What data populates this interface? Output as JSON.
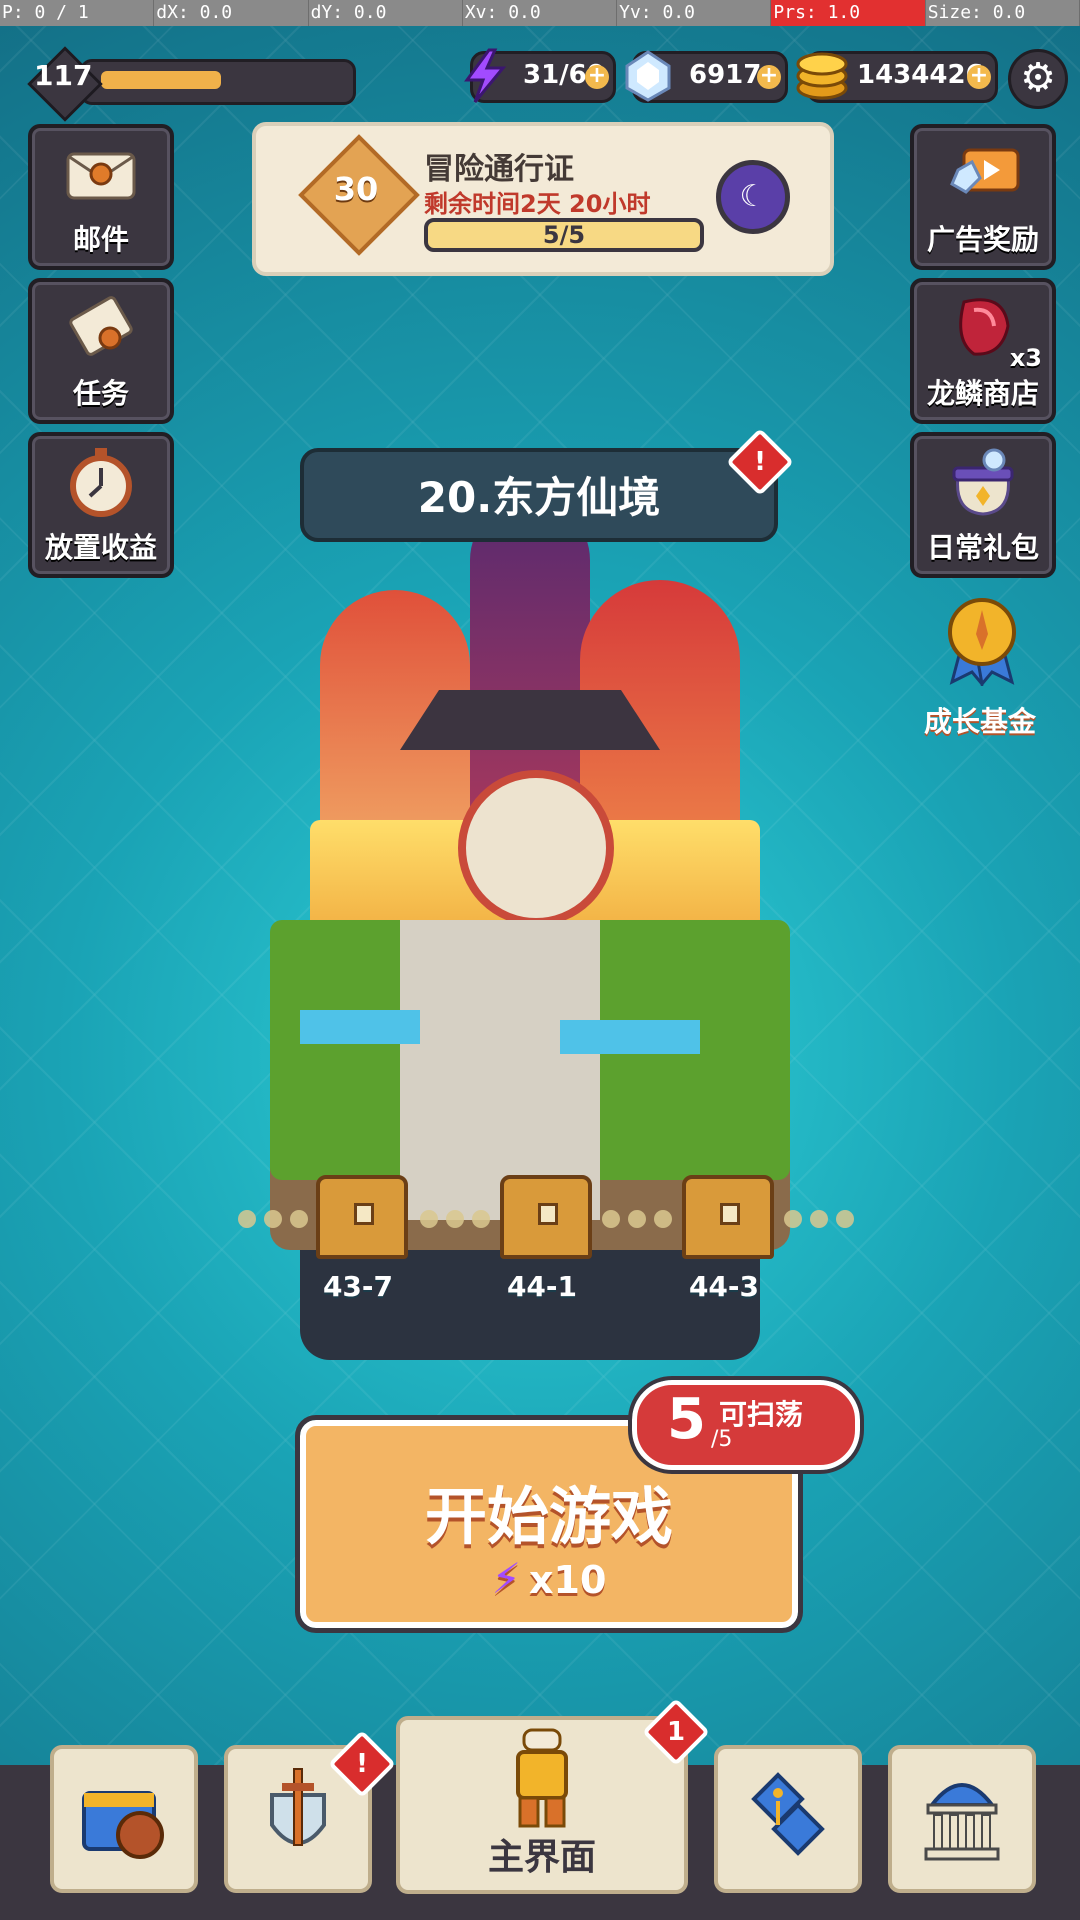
{
  "debug": {
    "pointer": "P: 0 / 1",
    "dx": "dX: 0.0",
    "dy": "dY: 0.0",
    "xv": "Xv: 0.0",
    "yv": "Yv: 0.0",
    "prs": "Prs: 1.0",
    "size": "Size: 0.0"
  },
  "hud": {
    "level": "117",
    "level_progress": 0.6,
    "energy": "31/60",
    "gems": "6917",
    "gold": "1434426",
    "plus": "+"
  },
  "side_left": [
    {
      "label": "邮件",
      "icon": "mail-icon"
    },
    {
      "label": "任务",
      "icon": "scroll-icon"
    },
    {
      "label": "放置收益",
      "icon": "stopwatch-icon"
    }
  ],
  "side_right": [
    {
      "label": "广告奖励",
      "icon": "tv-icon"
    },
    {
      "label": "龙鳞商店",
      "icon": "dragon-scale-icon",
      "badge": "x3"
    },
    {
      "label": "日常礼包",
      "icon": "gift-pot-icon"
    },
    {
      "label": "成长基金",
      "icon": "medal-icon"
    }
  ],
  "pass": {
    "level": "30",
    "title": "冒险通行证",
    "remaining": "剩余时间2天 20小时",
    "progress_text": "5/5",
    "progress": 1.0
  },
  "stage": {
    "title": "20.东方仙境",
    "alert": "!"
  },
  "chests": [
    {
      "label": "43-7"
    },
    {
      "label": "44-1"
    },
    {
      "label": "44-3"
    }
  ],
  "start": {
    "label": "开始游戏",
    "cost": "x10",
    "sweep_count": "5",
    "sweep_max": "/5",
    "sweep_label": "可扫荡"
  },
  "nav": {
    "main_label": "主界面",
    "main_badge": "1",
    "sword_badge": "!"
  },
  "colors": {
    "accent": "#f3b564",
    "panel": "#3b3640",
    "alert": "#d92d2d",
    "energy": "#a24bff"
  }
}
